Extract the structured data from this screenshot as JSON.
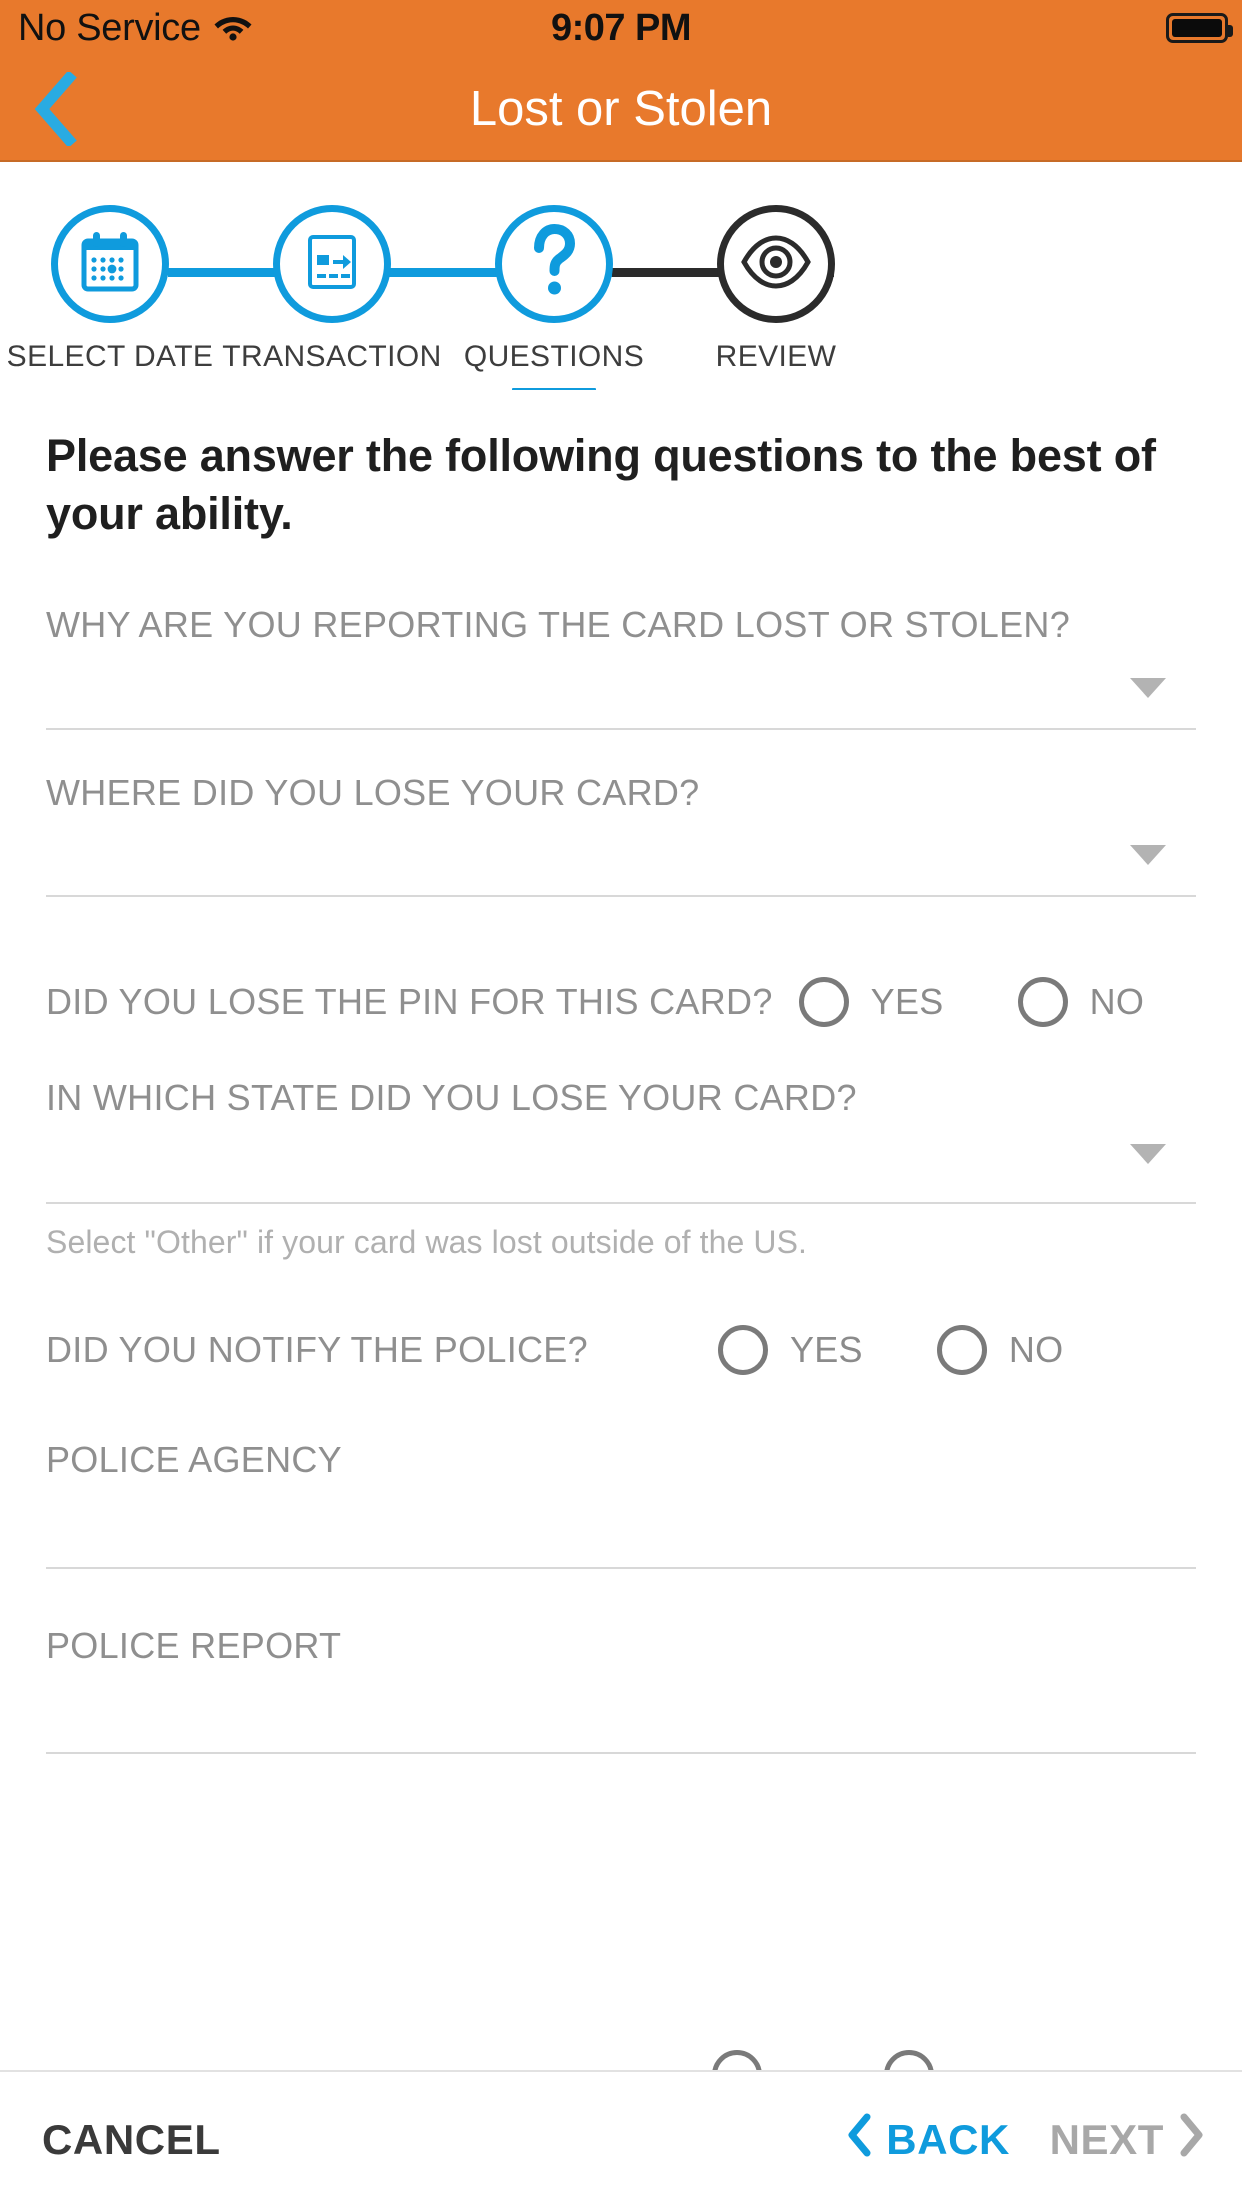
{
  "status_bar": {
    "carrier": "No Service",
    "wifi_icon": "wifi-icon",
    "time": "9:07 PM",
    "battery_icon": "battery-full-icon"
  },
  "nav": {
    "back_icon": "chevron-left-icon",
    "title": "Lost or Stolen"
  },
  "colors": {
    "header_orange": "#E8792C",
    "accent_blue": "#0F9BDD",
    "inactive_dark": "#2B2B2B",
    "label_gray": "#8F8F8F",
    "hint_gray": "#B0B0B0",
    "divider": "#D8D8D8"
  },
  "stepper": {
    "active_index": 2,
    "steps": [
      {
        "label": "SELECT DATE",
        "icon": "calendar-icon",
        "state": "complete"
      },
      {
        "label": "TRANSACTION",
        "icon": "transaction-card-icon",
        "state": "complete"
      },
      {
        "label": "QUESTIONS",
        "icon": "question-mark-icon",
        "state": "active"
      },
      {
        "label": "REVIEW",
        "icon": "eye-icon",
        "state": "upcoming"
      }
    ]
  },
  "form": {
    "intro": "Please answer the following questions to the best of your ability.",
    "fields": [
      {
        "type": "dropdown",
        "label": "WHY ARE YOU REPORTING THE CARD LOST OR STOLEN?",
        "value": "",
        "caret_icon": "chevron-down-icon"
      },
      {
        "type": "dropdown",
        "label": "WHERE DID YOU LOSE YOUR CARD?",
        "value": "",
        "caret_icon": "chevron-down-icon"
      },
      {
        "type": "radio",
        "label": "DID YOU LOSE THE PIN FOR THIS CARD?",
        "options": [
          "YES",
          "NO"
        ],
        "selected": ""
      },
      {
        "type": "dropdown",
        "label": "IN WHICH STATE DID YOU LOSE YOUR CARD?",
        "value": "",
        "caret_icon": "chevron-down-icon",
        "hint": "Select \"Other\" if your card was lost outside of the US."
      },
      {
        "type": "radio",
        "label": "DID YOU NOTIFY THE POLICE?",
        "options": [
          "YES",
          "NO"
        ],
        "selected": ""
      },
      {
        "type": "text",
        "label": "POLICE AGENCY",
        "value": ""
      },
      {
        "type": "text",
        "label": "POLICE REPORT",
        "value": ""
      }
    ]
  },
  "bottom_bar": {
    "cancel_label": "CANCEL",
    "back_label": "BACK",
    "back_icon": "chevron-left-icon",
    "next_label": "NEXT",
    "next_icon": "chevron-right-icon",
    "next_disabled": true
  }
}
